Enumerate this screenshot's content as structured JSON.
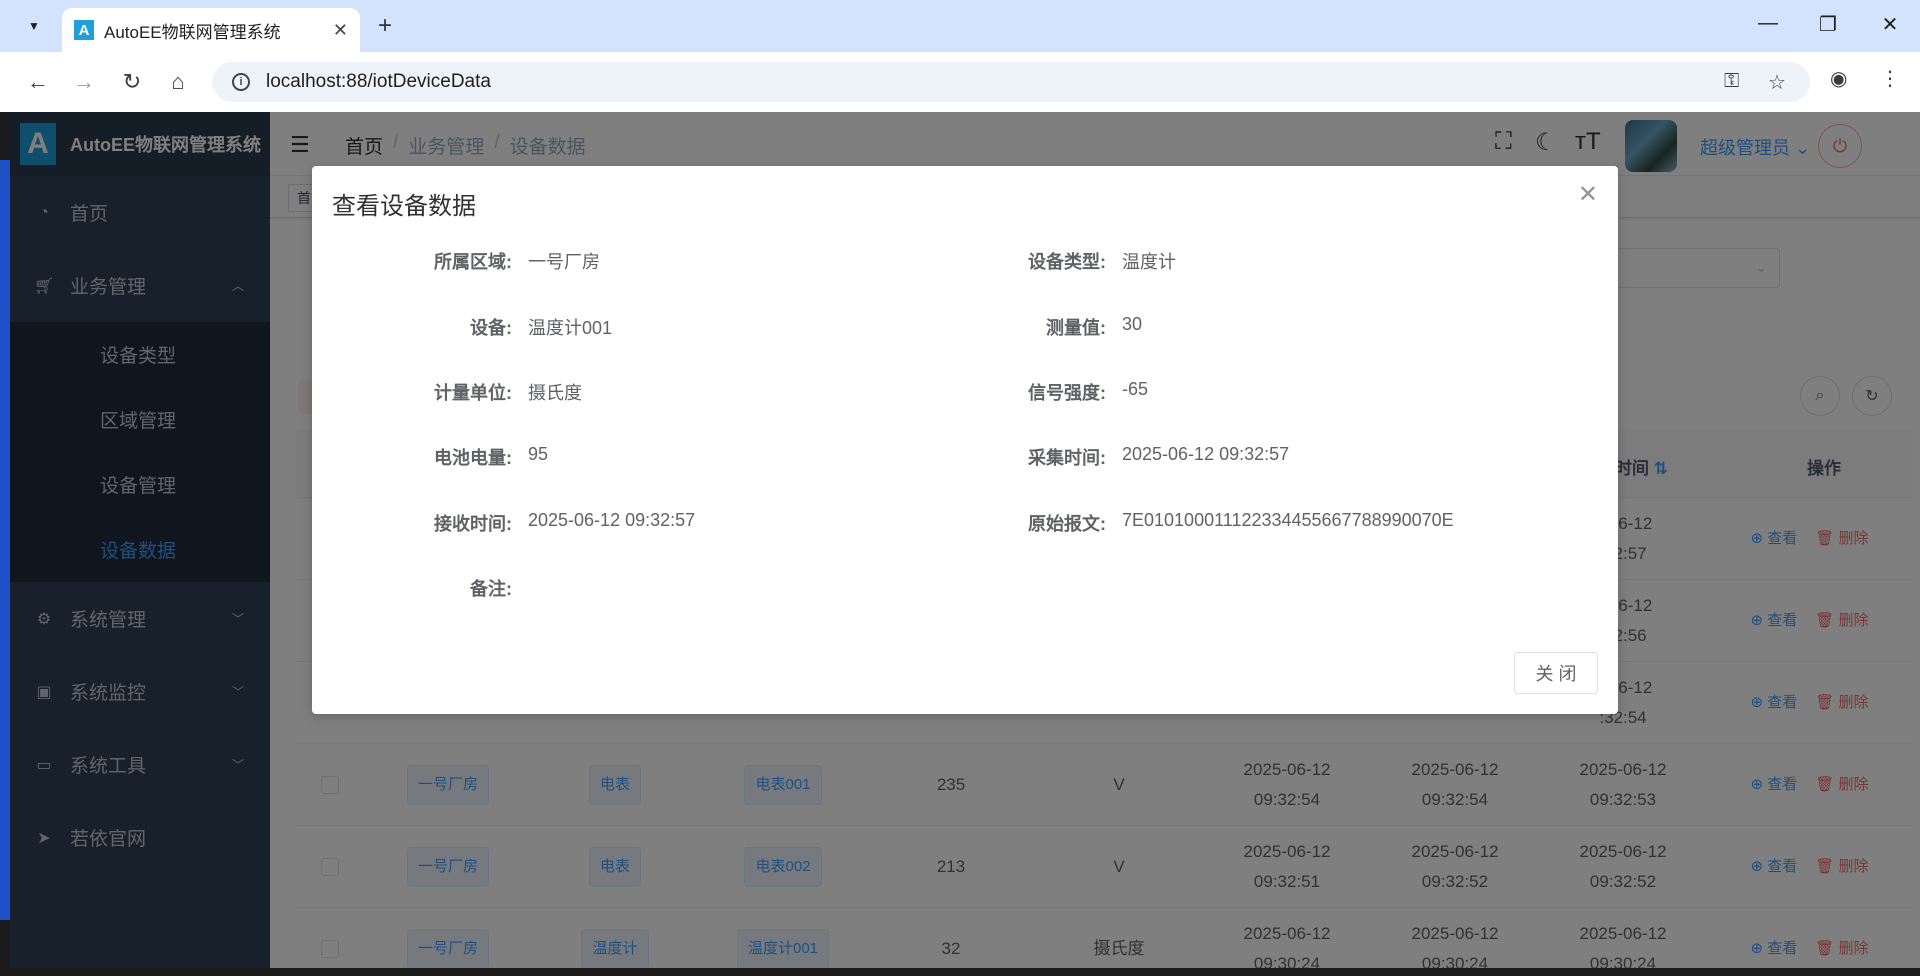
{
  "browser": {
    "tab_title": "AutoEE物联网管理系统",
    "url": "localhost:88/iotDeviceData"
  },
  "sidebar": {
    "logo_text": "AutoEE物联网管理系统",
    "items": [
      {
        "label": "首页",
        "icon": "dashboard-icon"
      },
      {
        "label": "业务管理",
        "icon": "cart-icon"
      },
      {
        "label": "系统管理",
        "icon": "gear-icon"
      },
      {
        "label": "系统监控",
        "icon": "monitor-icon"
      },
      {
        "label": "系统工具",
        "icon": "toolbox-icon"
      },
      {
        "label": "若依官网",
        "icon": "paper-plane-icon"
      }
    ],
    "sub_items": [
      "设备类型",
      "区域管理",
      "设备管理",
      "设备数据"
    ],
    "active_sub": "设备数据",
    "active_color": "#409eff"
  },
  "navbar": {
    "breadcrumb": [
      "首页",
      "业务管理",
      "设备数据"
    ],
    "user_name": "超级管理员"
  },
  "tags_view": {
    "first_tag": "首"
  },
  "table": {
    "headers": {
      "time_col": "时间",
      "actions": "操作"
    },
    "rows": [
      {
        "area": "",
        "type": "",
        "device": "",
        "value": "",
        "unit": "",
        "t1": "",
        "t2": "",
        "t3a": "5-06-12",
        "t3b": ":32:57"
      },
      {
        "area": "",
        "type": "",
        "device": "",
        "value": "",
        "unit": "",
        "t1": "",
        "t2": "",
        "t3a": "5-06-12",
        "t3b": ":32:56"
      },
      {
        "area": "",
        "type": "",
        "device": "",
        "value": "",
        "unit": "",
        "t1": "",
        "t2": "",
        "t3a": "5-06-12",
        "t3b": ":32:54"
      },
      {
        "area": "一号厂房",
        "type": "电表",
        "device": "电表001",
        "value": "235",
        "unit": "V",
        "t1": "2025-06-12 09:32:54",
        "t2": "2025-06-12 09:32:54",
        "t3a": "2025-06-12",
        "t3b": "09:32:53"
      },
      {
        "area": "一号厂房",
        "type": "电表",
        "device": "电表002",
        "value": "213",
        "unit": "V",
        "t1": "2025-06-12 09:32:51",
        "t2": "2025-06-12 09:32:52",
        "t3a": "2025-06-12",
        "t3b": "09:32:52"
      },
      {
        "area": "一号厂房",
        "type": "温度计",
        "device": "温度计001",
        "value": "32",
        "unit": "摄氏度",
        "t1": "2025-06-12 09:30:24",
        "t2": "2025-06-12 09:30:24",
        "t3a": "2025-06-12",
        "t3b": "09:30:24"
      }
    ],
    "view_label": "查看",
    "delete_label": "删除"
  },
  "dialog": {
    "title": "查看设备数据",
    "fields_left": [
      {
        "label": "所属区域:",
        "value": "一号厂房"
      },
      {
        "label": "设备:",
        "value": "温度计001"
      },
      {
        "label": "计量单位:",
        "value": "摄氏度"
      },
      {
        "label": "电池电量:",
        "value": "95"
      },
      {
        "label": "接收时间:",
        "value": "2025-06-12 09:32:57"
      },
      {
        "label": "备注:",
        "value": ""
      }
    ],
    "fields_right": [
      {
        "label": "设备类型:",
        "value": "温度计"
      },
      {
        "label": "测量值:",
        "value": "30"
      },
      {
        "label": "信号强度:",
        "value": "-65"
      },
      {
        "label": "采集时间:",
        "value": "2025-06-12 09:32:57"
      },
      {
        "label": "原始报文:",
        "value": "7E010100011122334455667788990070E"
      }
    ],
    "close_button": "关 闭"
  }
}
